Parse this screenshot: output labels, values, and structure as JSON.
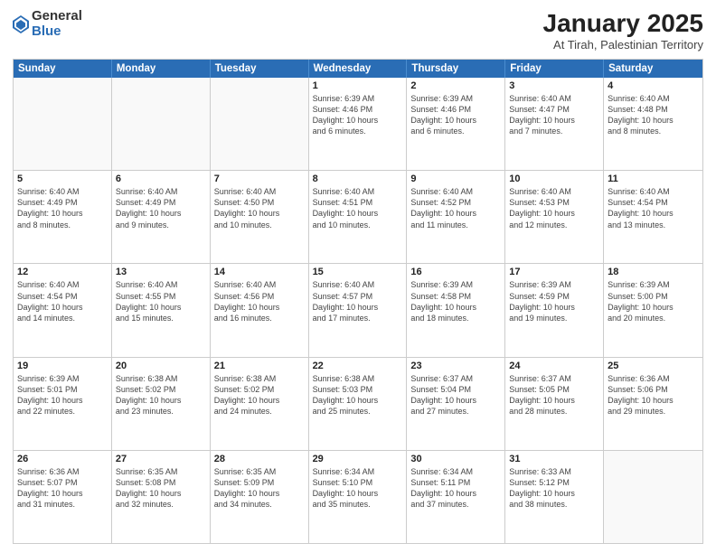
{
  "logo": {
    "general": "General",
    "blue": "Blue"
  },
  "title": "January 2025",
  "location": "At Tirah, Palestinian Territory",
  "weekdays": [
    "Sunday",
    "Monday",
    "Tuesday",
    "Wednesday",
    "Thursday",
    "Friday",
    "Saturday"
  ],
  "rows": [
    [
      {
        "day": "",
        "info": ""
      },
      {
        "day": "",
        "info": ""
      },
      {
        "day": "",
        "info": ""
      },
      {
        "day": "1",
        "info": "Sunrise: 6:39 AM\nSunset: 4:46 PM\nDaylight: 10 hours\nand 6 minutes."
      },
      {
        "day": "2",
        "info": "Sunrise: 6:39 AM\nSunset: 4:46 PM\nDaylight: 10 hours\nand 6 minutes."
      },
      {
        "day": "3",
        "info": "Sunrise: 6:40 AM\nSunset: 4:47 PM\nDaylight: 10 hours\nand 7 minutes."
      },
      {
        "day": "4",
        "info": "Sunrise: 6:40 AM\nSunset: 4:48 PM\nDaylight: 10 hours\nand 8 minutes."
      }
    ],
    [
      {
        "day": "5",
        "info": "Sunrise: 6:40 AM\nSunset: 4:49 PM\nDaylight: 10 hours\nand 8 minutes."
      },
      {
        "day": "6",
        "info": "Sunrise: 6:40 AM\nSunset: 4:49 PM\nDaylight: 10 hours\nand 9 minutes."
      },
      {
        "day": "7",
        "info": "Sunrise: 6:40 AM\nSunset: 4:50 PM\nDaylight: 10 hours\nand 10 minutes."
      },
      {
        "day": "8",
        "info": "Sunrise: 6:40 AM\nSunset: 4:51 PM\nDaylight: 10 hours\nand 10 minutes."
      },
      {
        "day": "9",
        "info": "Sunrise: 6:40 AM\nSunset: 4:52 PM\nDaylight: 10 hours\nand 11 minutes."
      },
      {
        "day": "10",
        "info": "Sunrise: 6:40 AM\nSunset: 4:53 PM\nDaylight: 10 hours\nand 12 minutes."
      },
      {
        "day": "11",
        "info": "Sunrise: 6:40 AM\nSunset: 4:54 PM\nDaylight: 10 hours\nand 13 minutes."
      }
    ],
    [
      {
        "day": "12",
        "info": "Sunrise: 6:40 AM\nSunset: 4:54 PM\nDaylight: 10 hours\nand 14 minutes."
      },
      {
        "day": "13",
        "info": "Sunrise: 6:40 AM\nSunset: 4:55 PM\nDaylight: 10 hours\nand 15 minutes."
      },
      {
        "day": "14",
        "info": "Sunrise: 6:40 AM\nSunset: 4:56 PM\nDaylight: 10 hours\nand 16 minutes."
      },
      {
        "day": "15",
        "info": "Sunrise: 6:40 AM\nSunset: 4:57 PM\nDaylight: 10 hours\nand 17 minutes."
      },
      {
        "day": "16",
        "info": "Sunrise: 6:39 AM\nSunset: 4:58 PM\nDaylight: 10 hours\nand 18 minutes."
      },
      {
        "day": "17",
        "info": "Sunrise: 6:39 AM\nSunset: 4:59 PM\nDaylight: 10 hours\nand 19 minutes."
      },
      {
        "day": "18",
        "info": "Sunrise: 6:39 AM\nSunset: 5:00 PM\nDaylight: 10 hours\nand 20 minutes."
      }
    ],
    [
      {
        "day": "19",
        "info": "Sunrise: 6:39 AM\nSunset: 5:01 PM\nDaylight: 10 hours\nand 22 minutes."
      },
      {
        "day": "20",
        "info": "Sunrise: 6:38 AM\nSunset: 5:02 PM\nDaylight: 10 hours\nand 23 minutes."
      },
      {
        "day": "21",
        "info": "Sunrise: 6:38 AM\nSunset: 5:02 PM\nDaylight: 10 hours\nand 24 minutes."
      },
      {
        "day": "22",
        "info": "Sunrise: 6:38 AM\nSunset: 5:03 PM\nDaylight: 10 hours\nand 25 minutes."
      },
      {
        "day": "23",
        "info": "Sunrise: 6:37 AM\nSunset: 5:04 PM\nDaylight: 10 hours\nand 27 minutes."
      },
      {
        "day": "24",
        "info": "Sunrise: 6:37 AM\nSunset: 5:05 PM\nDaylight: 10 hours\nand 28 minutes."
      },
      {
        "day": "25",
        "info": "Sunrise: 6:36 AM\nSunset: 5:06 PM\nDaylight: 10 hours\nand 29 minutes."
      }
    ],
    [
      {
        "day": "26",
        "info": "Sunrise: 6:36 AM\nSunset: 5:07 PM\nDaylight: 10 hours\nand 31 minutes."
      },
      {
        "day": "27",
        "info": "Sunrise: 6:35 AM\nSunset: 5:08 PM\nDaylight: 10 hours\nand 32 minutes."
      },
      {
        "day": "28",
        "info": "Sunrise: 6:35 AM\nSunset: 5:09 PM\nDaylight: 10 hours\nand 34 minutes."
      },
      {
        "day": "29",
        "info": "Sunrise: 6:34 AM\nSunset: 5:10 PM\nDaylight: 10 hours\nand 35 minutes."
      },
      {
        "day": "30",
        "info": "Sunrise: 6:34 AM\nSunset: 5:11 PM\nDaylight: 10 hours\nand 37 minutes."
      },
      {
        "day": "31",
        "info": "Sunrise: 6:33 AM\nSunset: 5:12 PM\nDaylight: 10 hours\nand 38 minutes."
      },
      {
        "day": "",
        "info": ""
      }
    ]
  ]
}
